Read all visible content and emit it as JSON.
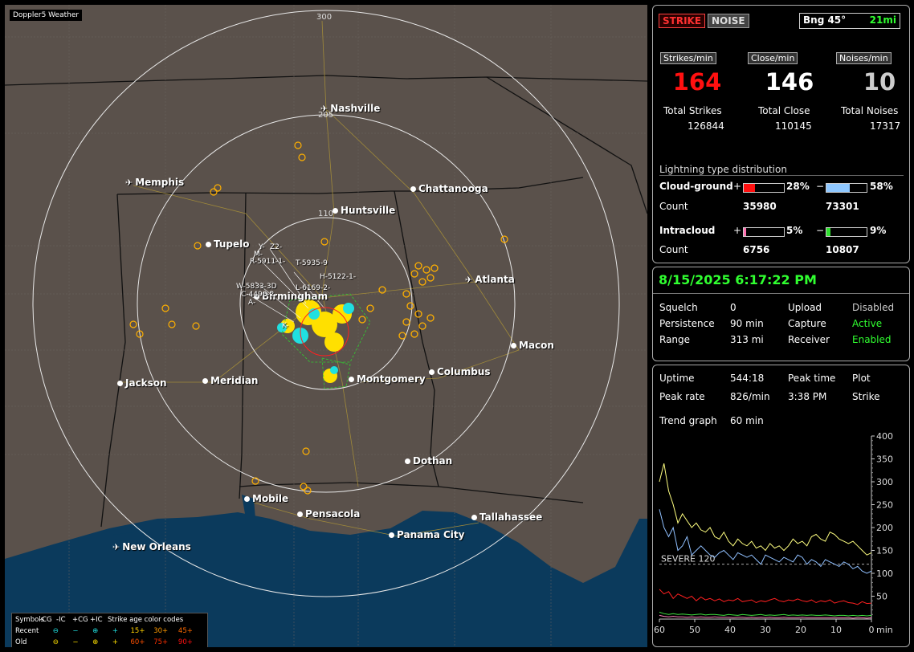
{
  "app_label": "Doppler5 Weather",
  "ring_labels": [
    "300",
    "205",
    "110"
  ],
  "cities": [
    {
      "name": "Nashville",
      "kind": "airport"
    },
    {
      "name": "Memphis",
      "kind": "airport"
    },
    {
      "name": "Chattanooga",
      "kind": "city"
    },
    {
      "name": "Huntsville",
      "kind": "city"
    },
    {
      "name": "Tupelo",
      "kind": "city"
    },
    {
      "name": "Atlanta",
      "kind": "airport"
    },
    {
      "name": "Birmingham",
      "kind": "city"
    },
    {
      "name": "Macon",
      "kind": "city"
    },
    {
      "name": "Jackson",
      "kind": "city"
    },
    {
      "name": "Meridian",
      "kind": "city"
    },
    {
      "name": "Montgomery",
      "kind": "city"
    },
    {
      "name": "Columbus",
      "kind": "city"
    },
    {
      "name": "Dothan",
      "kind": "city"
    },
    {
      "name": "Mobile",
      "kind": "city"
    },
    {
      "name": "Pensacola",
      "kind": "city"
    },
    {
      "name": "Tallahassee",
      "kind": "city"
    },
    {
      "name": "Panama City",
      "kind": "city"
    },
    {
      "name": "New Orleans",
      "kind": "airport"
    }
  ],
  "storm_labels": [
    "Y-",
    "M-",
    "R-5911-1-",
    "T-5935-9",
    "H-5122-1-",
    "W-5833-3D",
    "C-4490-2",
    "A-",
    "L-6169-2-",
    "Z2-",
    "K-"
  ],
  "legend": {
    "row1": [
      "Symbols",
      "-CG",
      "-IC",
      "+CG",
      "+IC",
      "Strike age color codes"
    ],
    "row2_label": "Recent",
    "row3_label": "Old",
    "age_recent": [
      "15+",
      "30+",
      "45+"
    ],
    "age_old": [
      "60+",
      "75+",
      "90+"
    ],
    "age_recent_colors": [
      "#ffd000",
      "#ff9a00",
      "#ff6a00"
    ],
    "age_old_colors": [
      "#ff5000",
      "#ff3000",
      "#ff1010"
    ]
  },
  "strike_panel": {
    "strike_button": "STRIKE",
    "noise_button": "NOISE",
    "bearing": "Bng 45°",
    "distance": "21mi",
    "headers": [
      "Strikes/min",
      "Close/min",
      "Noises/min"
    ],
    "rates": [
      "164",
      "146",
      "10"
    ],
    "rate_colors": [
      "#ff1010",
      "#ffffff",
      "#cccccc"
    ],
    "totals_labels": [
      "Total Strikes",
      "Total Close",
      "Total Noises"
    ],
    "totals": [
      "126844",
      "110145",
      "17317"
    ],
    "dist_title": "Lightning type distribution",
    "cloud_ground_label": "Cloud-ground",
    "cg_pos_pct": "28%",
    "cg_neg_pct": "58%",
    "cg_pos_fraction": 0.28,
    "cg_neg_fraction": 0.58,
    "count_label": "Count",
    "cg_pos_count": "35980",
    "cg_neg_count": "73301",
    "intracloud_label": "Intracloud",
    "ic_pos_pct": "5%",
    "ic_neg_pct": "9%",
    "ic_pos_fraction": 0.05,
    "ic_neg_fraction": 0.09,
    "ic_pos_count": "6756",
    "ic_neg_count": "10807",
    "plus": "+",
    "minus": "−",
    "colors": {
      "cg_pos": "#ff1010",
      "cg_neg": "#90c8ff",
      "ic_pos": "#ff70b0",
      "ic_neg": "#30e030"
    }
  },
  "status_panel": {
    "datetime": "8/15/2025 6:17:22 PM",
    "rows": [
      {
        "label": "Squelch",
        "value": "0",
        "label2": "Upload",
        "value2": "Disabled",
        "value2_color": "#cccccc"
      },
      {
        "label": "Persistence",
        "value": "90 min",
        "label2": "Capture",
        "value2": "Active",
        "value2_color": "#30ff30"
      },
      {
        "label": "Range",
        "value": "313 mi",
        "label2": "Receiver",
        "value2": "Enabled",
        "value2_color": "#30ff30"
      }
    ]
  },
  "stats_panel": {
    "uptime_label": "Uptime",
    "uptime": "544:18",
    "peak_time_label": "Peak time",
    "plot_label": "Plot",
    "peak_rate_label": "Peak rate",
    "peak_rate": "826/min",
    "peak_time": "3:38 PM",
    "plot_value": "Strike",
    "trend_label": "Trend graph",
    "trend_value": "60 min"
  },
  "chart_data": {
    "type": "line",
    "xlabel": "min",
    "x_ticks": [
      "60",
      "50",
      "40",
      "30",
      "20",
      "10",
      "0"
    ],
    "xlim": [
      60,
      0
    ],
    "ylim": [
      0,
      400
    ],
    "y_ticks": [
      "400",
      "350",
      "300",
      "250",
      "200",
      "150",
      "100",
      "50"
    ],
    "threshold": {
      "label": "SEVERE 120",
      "value": 120
    },
    "series": [
      {
        "color": "#ffff80",
        "values": [
          300,
          340,
          280,
          250,
          210,
          230,
          215,
          200,
          210,
          195,
          190,
          200,
          180,
          175,
          190,
          170,
          160,
          175,
          165,
          160,
          170,
          155,
          160,
          150,
          165,
          155,
          160,
          150,
          160,
          175,
          165,
          170,
          160,
          180,
          185,
          175,
          170,
          190,
          185,
          175,
          170,
          165,
          170,
          160,
          150,
          140,
          145
        ]
      },
      {
        "color": "#90c0ff",
        "values": [
          240,
          200,
          180,
          200,
          150,
          160,
          180,
          140,
          150,
          160,
          150,
          140,
          135,
          145,
          150,
          140,
          130,
          145,
          140,
          135,
          140,
          130,
          120,
          140,
          135,
          130,
          125,
          135,
          130,
          125,
          140,
          135,
          120,
          130,
          125,
          115,
          130,
          125,
          120,
          115,
          125,
          120,
          110,
          115,
          105,
          100,
          105
        ]
      },
      {
        "color": "#ff2020",
        "values": [
          65,
          55,
          60,
          45,
          55,
          50,
          45,
          50,
          40,
          48,
          42,
          45,
          40,
          44,
          38,
          42,
          40,
          45,
          38,
          40,
          42,
          36,
          40,
          38,
          42,
          45,
          40,
          38,
          42,
          40,
          44,
          40,
          38,
          42,
          36,
          40,
          38,
          42,
          35,
          38,
          40,
          36,
          35,
          32,
          38,
          34,
          35
        ]
      },
      {
        "color": "#40e040",
        "values": [
          15,
          12,
          10,
          12,
          10,
          11,
          10,
          9,
          10,
          11,
          9,
          10,
          10,
          9,
          8,
          10,
          9,
          8,
          10,
          9,
          8,
          9,
          10,
          8,
          9,
          8,
          9,
          10,
          8,
          9,
          8,
          9,
          8,
          9,
          8,
          8,
          9,
          8,
          7,
          8,
          8,
          7,
          8,
          7,
          8,
          7,
          8
        ]
      },
      {
        "color": "#ff80c0",
        "values": [
          8,
          6,
          5,
          6,
          5,
          5,
          4,
          5,
          4,
          5,
          4,
          4,
          5,
          4,
          4,
          4,
          3,
          4,
          4,
          3,
          4,
          3,
          4,
          3,
          4,
          3,
          3,
          4,
          3,
          3,
          3,
          4,
          3,
          3,
          3,
          3,
          3,
          3,
          3,
          3,
          3,
          3,
          2,
          3,
          3,
          2,
          3
        ]
      }
    ]
  }
}
